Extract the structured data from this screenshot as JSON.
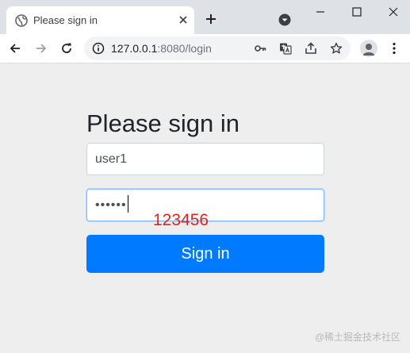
{
  "browser": {
    "tab_title": "Please sign in",
    "url_host": "127.0.0.1",
    "url_path": ":8080/login"
  },
  "form": {
    "heading": "Please sign in",
    "username_value": "user1",
    "password_mask": "••••••",
    "submit_label": "Sign in"
  },
  "annotation": "123456",
  "watermark": "@稀土掘金技术社区",
  "icons": {
    "favicon": "globe-icon",
    "tab_close": "close-icon",
    "new_tab": "plus-icon",
    "tab_search": "chevron-down-icon",
    "back": "arrow-left-icon",
    "forward": "arrow-right-icon",
    "reload": "reload-icon",
    "site_info": "info-icon",
    "password_manager": "key-icon",
    "translate": "translate-icon",
    "share": "share-icon",
    "bookmark": "star-icon",
    "profile": "avatar-icon",
    "menu": "kebab-menu-icon"
  },
  "colors": {
    "accent": "#007bff",
    "annotation": "#e8201a",
    "page_background": "#eeeeee"
  }
}
